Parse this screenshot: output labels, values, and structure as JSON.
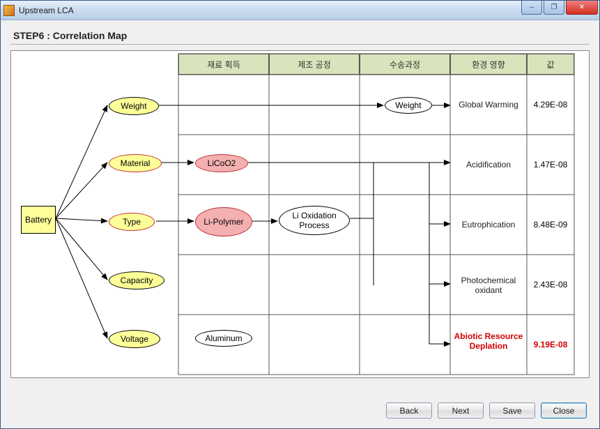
{
  "window": {
    "title": "Upstream LCA",
    "min_icon": "–",
    "max_icon": "❐",
    "close_icon": "✕"
  },
  "step_title": "STEP6 : Correlation Map",
  "headers": {
    "c1": "재료 획득",
    "c2": "제조 공정",
    "c3": "수송과정",
    "c4": "환경 영향",
    "c5": "값"
  },
  "root": "Battery",
  "attrs": {
    "weight": "Weight",
    "material": "Material",
    "type": "Type",
    "capacity": "Capacity",
    "voltage": "Voltage"
  },
  "col1": {
    "licoo2": "LiCoO2",
    "lipoly": "Li-Polymer",
    "aluminum": "Aluminum"
  },
  "col2": {
    "oxid": "Li Oxidation Process"
  },
  "col3": {
    "weight": "Weight"
  },
  "impacts": {
    "r1": "Global Warming",
    "r2": "Acidification",
    "r3": "Eutrophication",
    "r4": "Photochemical oxidant",
    "r5": "Abiotic Resource Deplation"
  },
  "values": {
    "r1": "4.29E-08",
    "r2": "1.47E-08",
    "r3": "8.48E-09",
    "r4": "2.43E-08",
    "r5": "9.19E-08"
  },
  "buttons": {
    "back": "Back",
    "next": "Next",
    "save": "Save",
    "close": "Close"
  }
}
